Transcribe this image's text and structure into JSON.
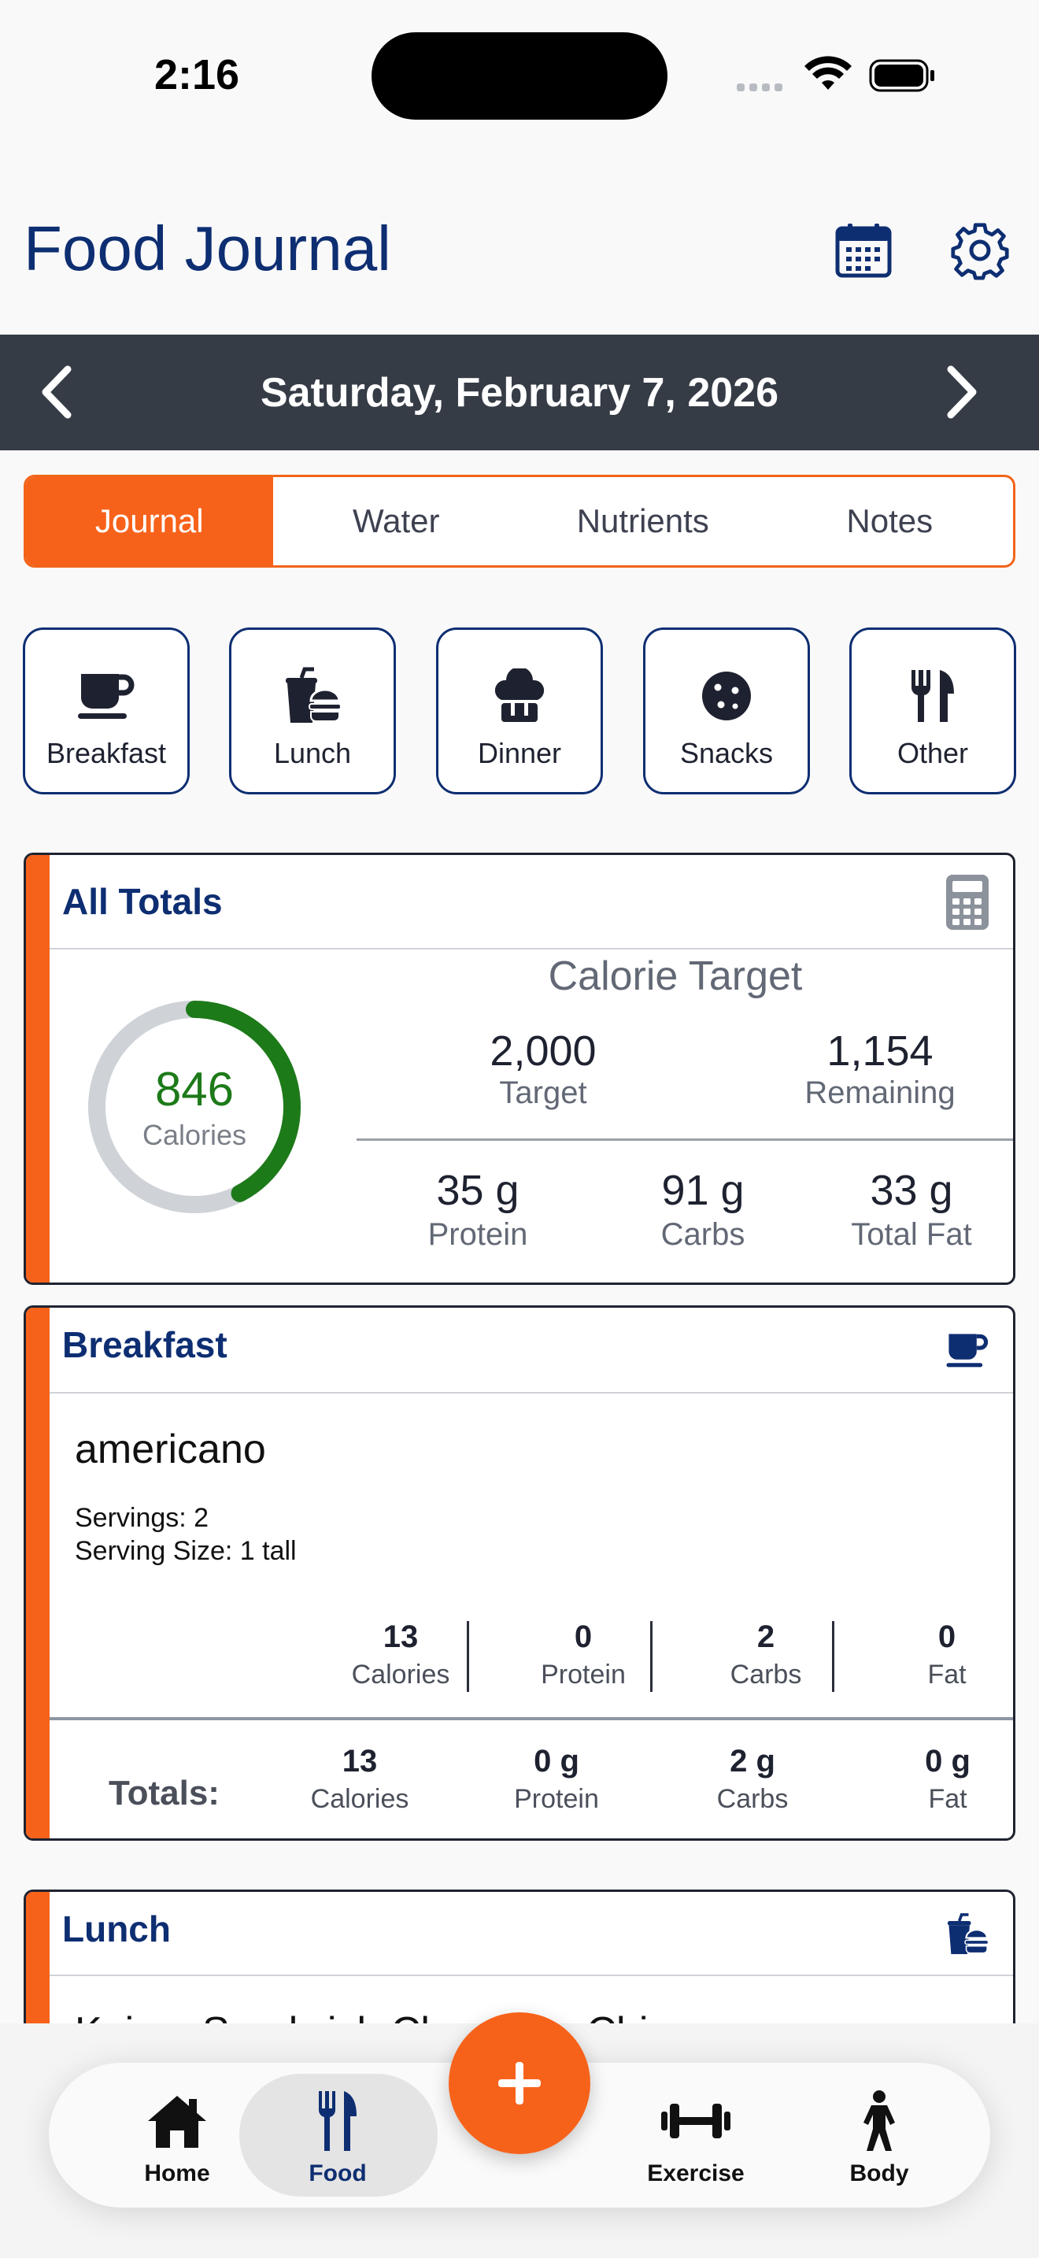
{
  "status_bar": {
    "time": "2:16"
  },
  "header": {
    "title": "Food Journal"
  },
  "date_bar": {
    "date": "Saturday, February 7, 2026"
  },
  "tabs": [
    {
      "label": "Journal",
      "active": true
    },
    {
      "label": "Water",
      "active": false
    },
    {
      "label": "Nutrients",
      "active": false
    },
    {
      "label": "Notes",
      "active": false
    }
  ],
  "meals": [
    {
      "label": "Breakfast",
      "icon": "coffee-cup-icon"
    },
    {
      "label": "Lunch",
      "icon": "drink-burger-icon"
    },
    {
      "label": "Dinner",
      "icon": "chef-hat-icon"
    },
    {
      "label": "Snacks",
      "icon": "cookie-icon"
    },
    {
      "label": "Other",
      "icon": "utensils-icon"
    }
  ],
  "totals": {
    "title": "All Totals",
    "calories": "846",
    "calories_label": "Calories",
    "calorie_progress": 0.423,
    "calorie_target_title": "Calorie Target",
    "target": "2,000",
    "target_label": "Target",
    "remaining": "1,154",
    "remaining_label": "Remaining",
    "protein": "35 g",
    "protein_label": "Protein",
    "carbs": "91 g",
    "carbs_label": "Carbs",
    "fat": "33 g",
    "fat_label": "Total Fat"
  },
  "breakfast": {
    "title": "Breakfast",
    "item": {
      "name": "americano",
      "servings": "Servings: 2",
      "serving_size": "Serving Size: 1 tall",
      "nutrients": [
        {
          "value": "13",
          "label": "Calories"
        },
        {
          "value": "0",
          "label": "Protein"
        },
        {
          "value": "2",
          "label": "Carbs"
        },
        {
          "value": "0",
          "label": "Fat"
        }
      ]
    },
    "totals_label": "Totals:",
    "totals": [
      {
        "value": "13",
        "label": "Calories"
      },
      {
        "value": "0 g",
        "label": "Protein"
      },
      {
        "value": "2 g",
        "label": "Carbs"
      },
      {
        "value": "0 g",
        "label": "Fat"
      }
    ]
  },
  "lunch": {
    "title": "Lunch",
    "first_item_partial": "Kaiser Sandwich Chocolate Chip"
  },
  "tab_bar": [
    {
      "label": "Home",
      "icon": "home-icon",
      "active": false
    },
    {
      "label": "Food",
      "icon": "fork-knife-icon",
      "active": true
    },
    {
      "label": "Exercise",
      "icon": "dumbbell-icon",
      "active": false
    },
    {
      "label": "Body",
      "icon": "person-icon",
      "active": false
    }
  ],
  "colors": {
    "navy": "#0e2e72",
    "orange": "#f7621a",
    "date_bar": "#363c46",
    "progress_green": "#1d7a19"
  }
}
